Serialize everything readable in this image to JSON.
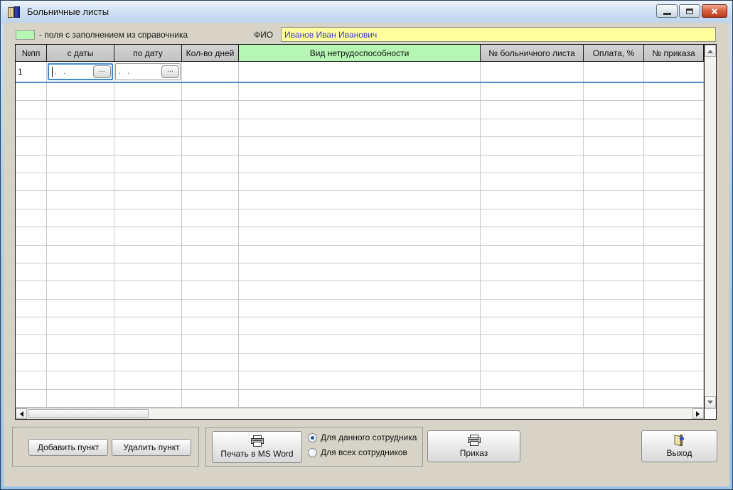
{
  "window": {
    "title": "Больничные листы"
  },
  "legend": {
    "text": "- поля с заполнением из справочника"
  },
  "fio": {
    "label": "ФИО",
    "value": "Иванов Иван Иванович"
  },
  "table": {
    "columns": [
      {
        "label": "№пп"
      },
      {
        "label": "с даты"
      },
      {
        "label": "по дату"
      },
      {
        "label": "Кол-во дней"
      },
      {
        "label": "Вид нетрудоспособности"
      },
      {
        "label": "№ больничного листа"
      },
      {
        "label": "Оплата, %"
      },
      {
        "label": "№ приказа"
      }
    ],
    "first_row": {
      "number": "1",
      "from_date_mask": ".  .",
      "to_date_mask": ".  .",
      "picker_label": "..."
    },
    "empty_row_count": 18
  },
  "footer": {
    "add_item": "Добавить пункт",
    "delete_item": "Удалить пункт",
    "print_word": "Печать в MS Word",
    "scope_options": [
      {
        "label": "Для данного сотрудника",
        "selected": true
      },
      {
        "label": "Для всех сотрудников",
        "selected": false
      }
    ],
    "order": "Приказ",
    "exit": "Выход"
  },
  "colors": {
    "reference_field_green": "#b5f6b5",
    "fio_field_yellow": "#ffff9e",
    "selection_blue": "#4f8fd0",
    "close_button_red": "#bb3a1c"
  }
}
